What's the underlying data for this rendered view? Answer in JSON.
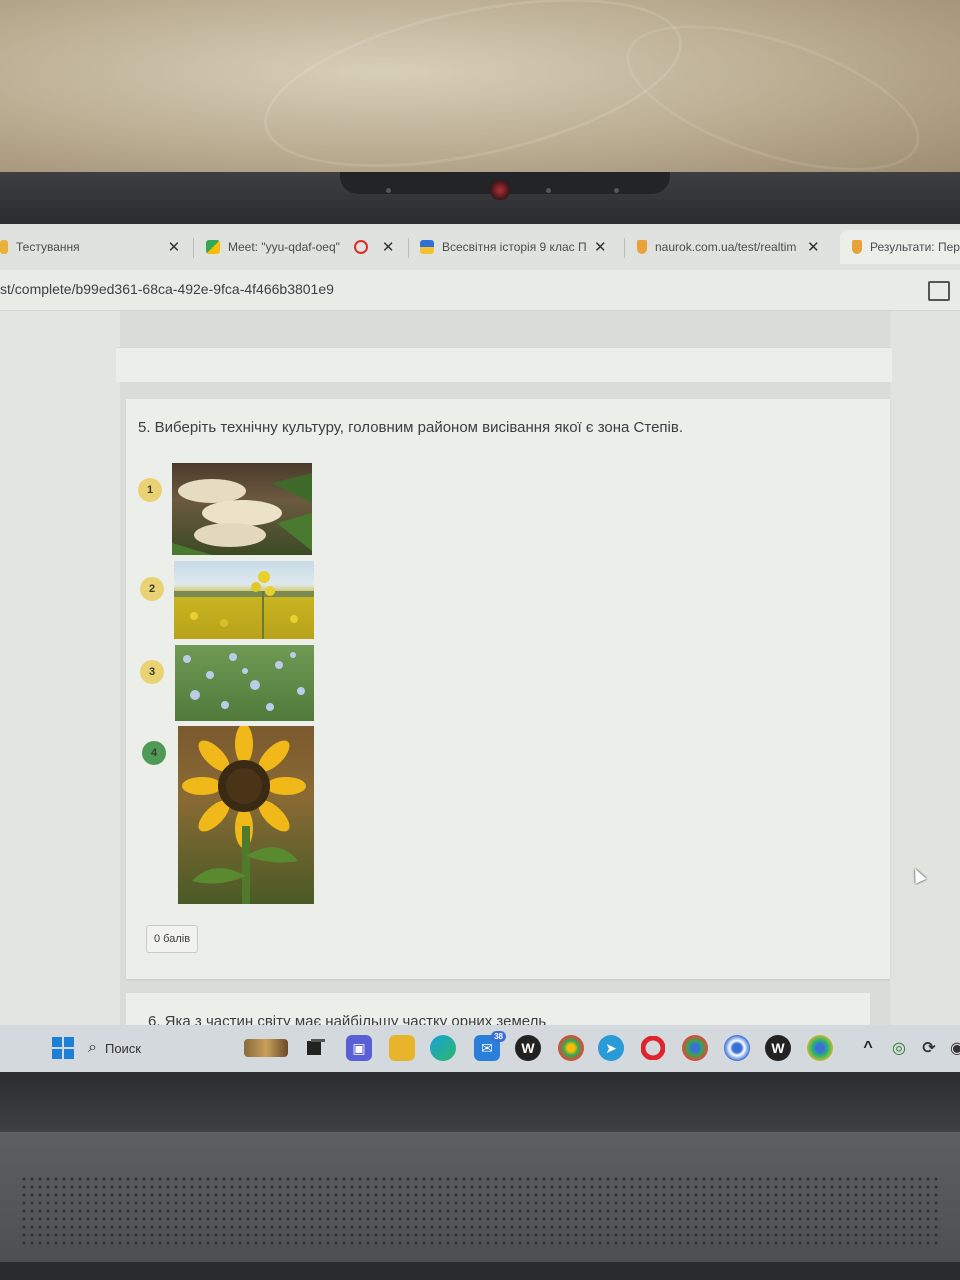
{
  "browser": {
    "tabs": [
      {
        "title": "Тестування",
        "has_close": true
      },
      {
        "title": "Meet: \"yyu-qdaf-oeq\"",
        "has_close": true,
        "recording": true
      },
      {
        "title": "Всесвітня історія 9 клас П",
        "has_close": true
      },
      {
        "title": "naurok.com.ua/test/realtim",
        "has_close": true
      },
      {
        "title": "Результати: Пер",
        "has_close": false
      }
    ],
    "url": "st/complete/b99ed361-68ca-492e-9fca-4f466b3801e9"
  },
  "question": {
    "text": "5. Виберіть технічну культуру, головним районом висівання якої є зона Степів.",
    "options": [
      {
        "number": "1",
        "image": "sugar beet roots",
        "color": "#e8d273"
      },
      {
        "number": "2",
        "image": "rapeseed field",
        "color": "#e8d273"
      },
      {
        "number": "3",
        "image": "flax field",
        "color": "#e8d273"
      },
      {
        "number": "4",
        "image": "sunflower",
        "color": "#4f9a55"
      }
    ],
    "score": "0 балів"
  },
  "next_question": {
    "text": "6. Яка з частин світу має найбільшу частку орних земель"
  },
  "taskbar": {
    "search_placeholder": "Поиск",
    "mail_badge": "38"
  }
}
